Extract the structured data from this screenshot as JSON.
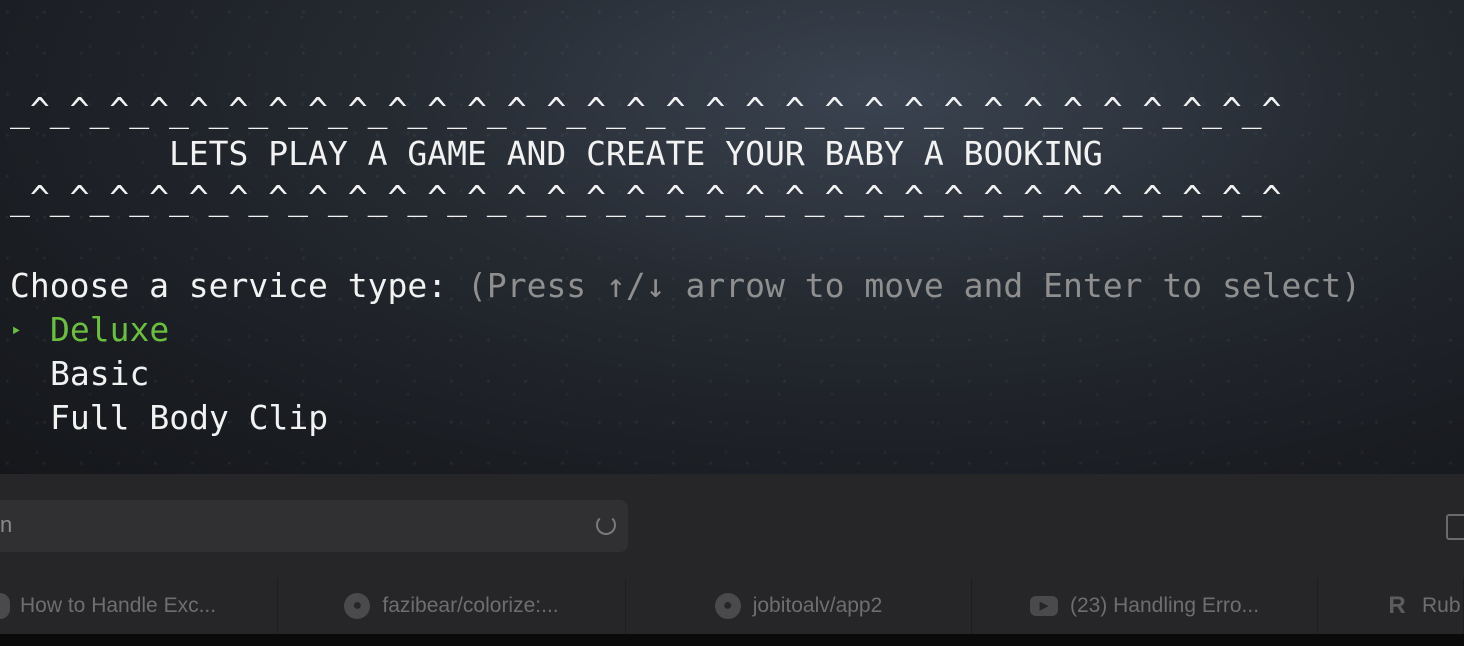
{
  "terminal": {
    "border_top": "_^_^_^_^_^_^_^_^_^_^_^_^_^_^_^_^_^_^_^_^_^_^_^_^_^_^_^_^_^_^_^_^",
    "title": "        LETS PLAY A GAME AND CREATE YOUR BABY A BOOKING",
    "border_bottom": "_^_^_^_^_^_^_^_^_^_^_^_^_^_^_^_^_^_^_^_^_^_^_^_^_^_^_^_^_^_^_^_^",
    "prompt": {
      "question": "Choose a service type: ",
      "hint": "(Press ↑/↓ arrow to move and Enter to select)"
    },
    "pointer_glyph": "‣",
    "options": [
      {
        "label": "Deluxe",
        "selected": true
      },
      {
        "label": "Basic",
        "selected": false
      },
      {
        "label": "Full Body Clip",
        "selected": false
      }
    ]
  },
  "browser": {
    "address_text": "n",
    "tabs": [
      {
        "label": "How to Handle Exc...",
        "icon": "page-icon"
      },
      {
        "label": "fazibear/colorize:...",
        "icon": "github-icon"
      },
      {
        "label": "jobitoalv/app2",
        "icon": "github-icon"
      },
      {
        "label": "(23) Handling Erro...",
        "icon": "youtube-icon"
      },
      {
        "label": "Rub",
        "icon": "r-icon"
      }
    ]
  },
  "colors": {
    "selected_option": "#6bbf3e",
    "hint_text": "#8f8f8f",
    "terminal_text": "#f2f2f2"
  }
}
